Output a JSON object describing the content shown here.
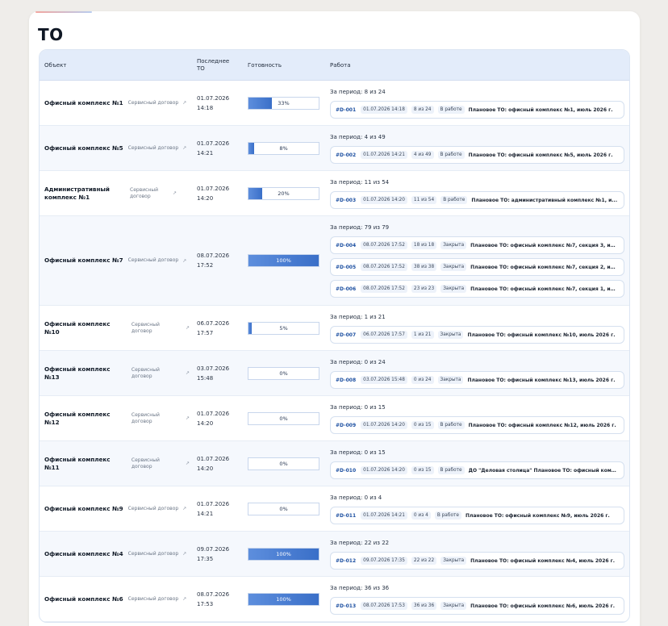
{
  "page": {
    "title": "ТО"
  },
  "table": {
    "headers": {
      "object": "Объект",
      "last_to_line1": "Последнее",
      "last_to_line2": "ТО",
      "readiness": "Готовность",
      "work": "Работа"
    },
    "rows": [
      {
        "object": "Офисный комплекс №1",
        "contract": "Сервисный договор",
        "date": "01.07.2026",
        "time": "14:18",
        "progress": 0.33,
        "progress_label": "33%",
        "period": "За период: 8 из 24",
        "tickets": [
          {
            "id": "#D-001",
            "date": "01.07.2026 14:18",
            "count": "8 из 24",
            "status": "В работе",
            "title": "Плановое ТО: офисный комплекс №1, июль 2026 г."
          }
        ]
      },
      {
        "object": "Офисный комплекс №5",
        "contract": "Сервисный договор",
        "date": "01.07.2026",
        "time": "14:21",
        "progress": 0.08,
        "progress_label": "8%",
        "period": "За период: 4 из 49",
        "tickets": [
          {
            "id": "#D-002",
            "date": "01.07.2026 14:21",
            "count": "4 из 49",
            "status": "В работе",
            "title": "Плановое ТО: офисный комплекс №5, июль 2026 г."
          }
        ]
      },
      {
        "object": "Административный комплекс №1",
        "contract": "Сервисный договор",
        "date": "01.07.2026",
        "time": "14:20",
        "progress": 0.2,
        "progress_label": "20%",
        "period": "За период: 11 из 54",
        "tickets": [
          {
            "id": "#D-003",
            "date": "01.07.2026 14:20",
            "count": "11 из 54",
            "status": "В работе",
            "title": "Плановое ТО: административный комплекс №1, и..."
          }
        ]
      },
      {
        "object": "Офисный комплекс №7",
        "contract": "Сервисный договор",
        "date": "08.07.2026",
        "time": "17:52",
        "progress": 1.0,
        "progress_label": "100%",
        "period": "За период: 79 из 79",
        "tickets": [
          {
            "id": "#D-004",
            "date": "08.07.2026 17:52",
            "count": "18 из 18",
            "status": "Закрыта",
            "title": "Плановое ТО: офисный комплекс №7, секция 3, ию..."
          },
          {
            "id": "#D-005",
            "date": "08.07.2026 17:52",
            "count": "38 из 38",
            "status": "Закрыта",
            "title": "Плановое ТО: офисный комплекс №7, секция 2, ию..."
          },
          {
            "id": "#D-006",
            "date": "08.07.2026 17:52",
            "count": "23 из 23",
            "status": "Закрыта",
            "title": "Плановое ТО: офисный комплекс №7, секция 1, ию..."
          }
        ]
      },
      {
        "object": "Офисный комплекс №10",
        "contract": "Сервисный договор",
        "date": "06.07.2026",
        "time": "17:57",
        "progress": 0.05,
        "progress_label": "5%",
        "period": "За период: 1 из 21",
        "tickets": [
          {
            "id": "#D-007",
            "date": "06.07.2026 17:57",
            "count": "1 из 21",
            "status": "Закрыта",
            "title": "Плановое ТО: офисный комплекс №10, июль 2026 г."
          }
        ]
      },
      {
        "object": "Офисный комплекс №13",
        "contract": "Сервисный договор",
        "date": "03.07.2026",
        "time": "15:48",
        "progress": 0,
        "progress_label": "0%",
        "period": "За период: 0 из 24",
        "tickets": [
          {
            "id": "#D-008",
            "date": "03.07.2026 15:48",
            "count": "0 из 24",
            "status": "Закрыта",
            "title": "Плановое ТО: офисный комплекс №13, июль 2026 г."
          }
        ]
      },
      {
        "object": "Офисный комплекс №12",
        "contract": "Сервисный договор",
        "date": "01.07.2026",
        "time": "14:20",
        "progress": 0,
        "progress_label": "0%",
        "period": "За период: 0 из 15",
        "tickets": [
          {
            "id": "#D-009",
            "date": "01.07.2026 14:20",
            "count": "0 из 15",
            "status": "В работе",
            "title": "Плановое ТО: офисный комплекс №12, июль 2026 г."
          }
        ]
      },
      {
        "object": "Офисный комплекс №11",
        "contract": "Сервисный договор",
        "date": "01.07.2026",
        "time": "14:20",
        "progress": 0,
        "progress_label": "0%",
        "period": "За период: 0 из 15",
        "tickets": [
          {
            "id": "#D-010",
            "date": "01.07.2026 14:20",
            "count": "0 из 15",
            "status": "В работе",
            "title": "ДО \"Деловая столица\" Плановое ТО: офисный комп..."
          }
        ]
      },
      {
        "object": "Офисный комплекс №9",
        "contract": "Сервисный договор",
        "date": "01.07.2026",
        "time": "14:21",
        "progress": 0,
        "progress_label": "0%",
        "period": "За период: 0 из 4",
        "tickets": [
          {
            "id": "#D-011",
            "date": "01.07.2026 14:21",
            "count": "0 из 4",
            "status": "В работе",
            "title": "Плановое ТО: офисный комплекс №9, июль 2026 г."
          }
        ]
      },
      {
        "object": "Офисный комплекс №4",
        "contract": "Сервисный договор",
        "date": "09.07.2026",
        "time": "17:35",
        "progress": 1.0,
        "progress_label": "100%",
        "period": "За период: 22 из 22",
        "tickets": [
          {
            "id": "#D-012",
            "date": "09.07.2026 17:35",
            "count": "22 из 22",
            "status": "Закрыта",
            "title": "Плановое ТО: офисный комплекс №4, июль 2026 г."
          }
        ]
      },
      {
        "object": "Офисный комплекс №6",
        "contract": "Сервисный договор",
        "date": "08.07.2026",
        "time": "17:53",
        "progress": 1.0,
        "progress_label": "100%",
        "period": "За период: 36 из 36",
        "tickets": [
          {
            "id": "#D-013",
            "date": "08.07.2026 17:53",
            "count": "36 из 36",
            "status": "Закрыта",
            "title": "Плановое ТО: офисный комплекс №6, июль 2026 г."
          }
        ]
      }
    ]
  },
  "colors": {
    "header_bg": "#e3ecfa",
    "progress_fill": "#3a6fc8",
    "ticket_id": "#1c4fa1"
  },
  "icons": {
    "external_link": "external-link-icon"
  }
}
